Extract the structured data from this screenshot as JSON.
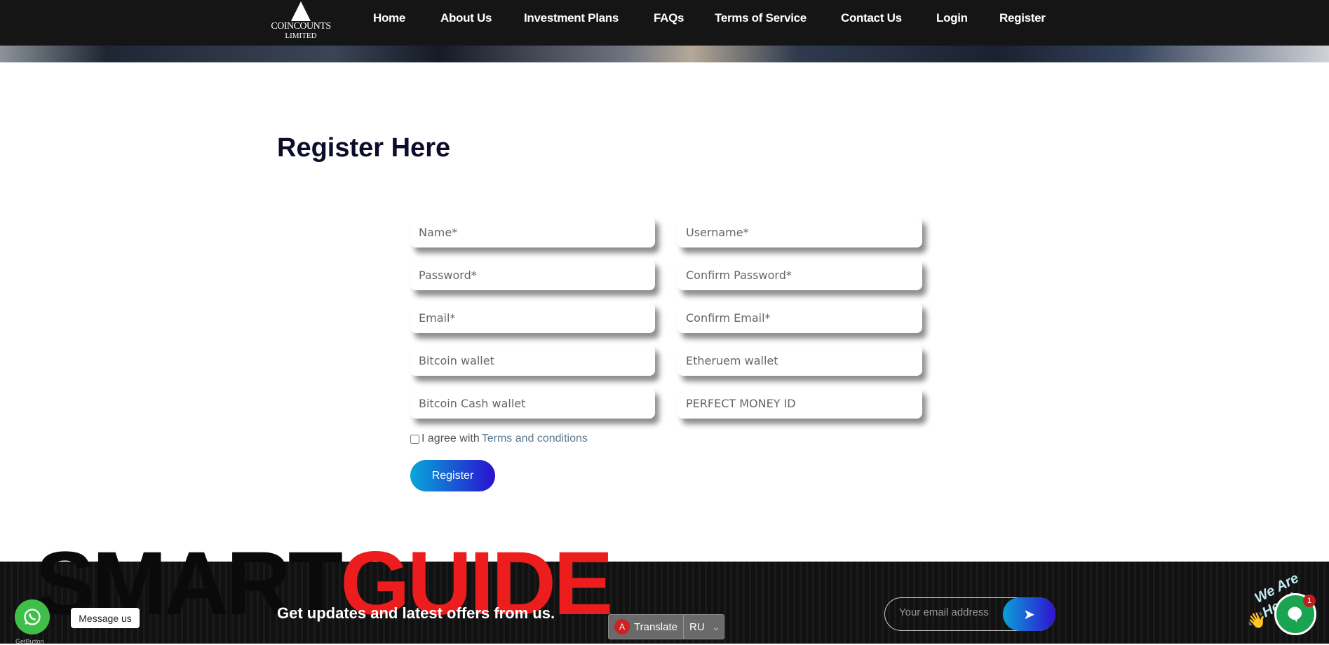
{
  "nav": {
    "logo": {
      "line1": "COINCOUNTS",
      "line2": "LIMITED"
    },
    "items": [
      {
        "label": "Home"
      },
      {
        "label": "About Us"
      },
      {
        "label": "Investment Plans"
      },
      {
        "label": "FAQs"
      },
      {
        "label": "Terms of Service"
      },
      {
        "label": "Contact Us"
      },
      {
        "label": "Login"
      },
      {
        "label": "Register"
      }
    ]
  },
  "main": {
    "title": "Register Here",
    "fields": [
      {
        "placeholder": "Name*"
      },
      {
        "placeholder": "Username*"
      },
      {
        "placeholder": "Password*"
      },
      {
        "placeholder": "Confirm Password*"
      },
      {
        "placeholder": "Email*"
      },
      {
        "placeholder": "Confirm Email*"
      },
      {
        "placeholder": "Bitcoin wallet"
      },
      {
        "placeholder": "Etheruem wallet"
      },
      {
        "placeholder": "Bitcoin Cash wallet"
      },
      {
        "placeholder": "PERFECT MONEY ID"
      }
    ],
    "agree_text": "I agree with",
    "terms_link": "Terms and conditions",
    "submit": "Register"
  },
  "footer": {
    "banner_smart": "SMART",
    "banner_guide": "GUIDE",
    "newsletter_text": "Get updates and latest offers from us.",
    "email_placeholder": "Your email address",
    "send_icon": "paper-plane-icon",
    "translate": {
      "label": "Translate",
      "lang": "RU"
    }
  },
  "widgets": {
    "whatsapp_label": "Message us",
    "getbutton": "GetButton",
    "chat_tagline": "We Are Here!",
    "chat_badge": "1"
  },
  "colors": {
    "accent_start": "#07a7d9",
    "accent_end": "#2a10cf",
    "guide_red": "#ee1d1d",
    "nav_bg": "#151515"
  }
}
